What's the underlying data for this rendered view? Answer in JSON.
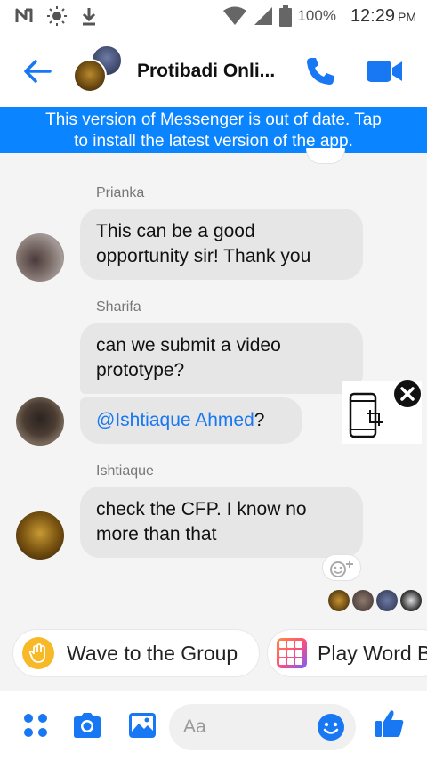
{
  "status_bar": {
    "battery": "100%",
    "time": "12:29",
    "ampm": "PM"
  },
  "header": {
    "title": "Protibadi Onli..."
  },
  "banner": {
    "line1": "This version of Messenger is out of date. Tap",
    "line2": "to install the latest version of the app."
  },
  "messages": [
    {
      "sender": "Prianka",
      "lines": [
        "This can be a good",
        "opportunity sir! Thank you"
      ]
    },
    {
      "sender": "Sharifa",
      "lines": [
        "can we submit a video",
        "prototype?"
      ],
      "mention": "@Ishtiaque Ahmed",
      "mention_suffix": "?"
    },
    {
      "sender": "Ishtiaque",
      "lines": [
        "check the CFP. I know no",
        "more than that"
      ]
    }
  ],
  "quick_replies": {
    "wave": "Wave to the Group",
    "word": "Play Word B"
  },
  "composer": {
    "placeholder": "Aa"
  },
  "colors": {
    "accent": "#0a84ff",
    "messenger_blue": "#1877f2",
    "bubble": "#e6e6e6"
  }
}
